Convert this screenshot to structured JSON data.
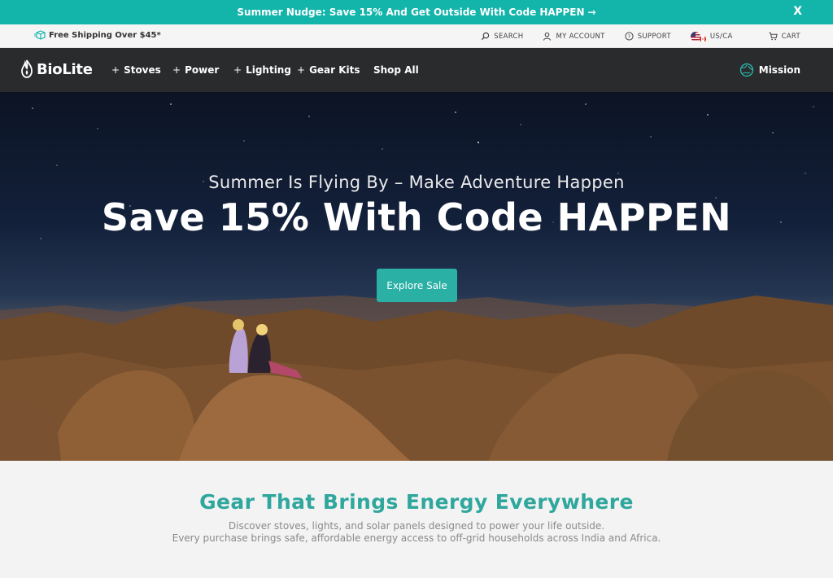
{
  "promo": {
    "text": "Summer Nudge: Save 15% And Get Outside With Code HAPPEN",
    "arrow": "→",
    "close": "X"
  },
  "utility": {
    "shipping": "Free Shipping Over $45*",
    "search": "SEARCH",
    "account": "MY ACCOUNT",
    "support": "SUPPORT",
    "region": "US/CA",
    "cart": "CART"
  },
  "nav": {
    "logo": "BioLite",
    "items": [
      {
        "label": "Stoves",
        "plus": "+"
      },
      {
        "label": "Power",
        "plus": "+"
      },
      {
        "label": "Lighting",
        "plus": "+"
      },
      {
        "label": "Gear Kits",
        "plus": "+"
      }
    ],
    "shop_all": "Shop All",
    "mission": "Mission"
  },
  "hero": {
    "subtitle": "Summer Is Flying By – Make Adventure Happen",
    "headline": "Save 15% With Code HAPPEN",
    "cta": "Explore Sale"
  },
  "section": {
    "title": "Gear That Brings Energy Everywhere",
    "line1": "Discover stoves, lights, and solar panels designed to power your life outside.",
    "line2": "Every purchase brings safe, affordable energy access to off-grid households across India and Africa."
  },
  "colors": {
    "accent": "#13b5ab",
    "nav_bg": "#2a2b2d",
    "cta": "#2ab0a5",
    "section_title": "#2fa79d"
  }
}
